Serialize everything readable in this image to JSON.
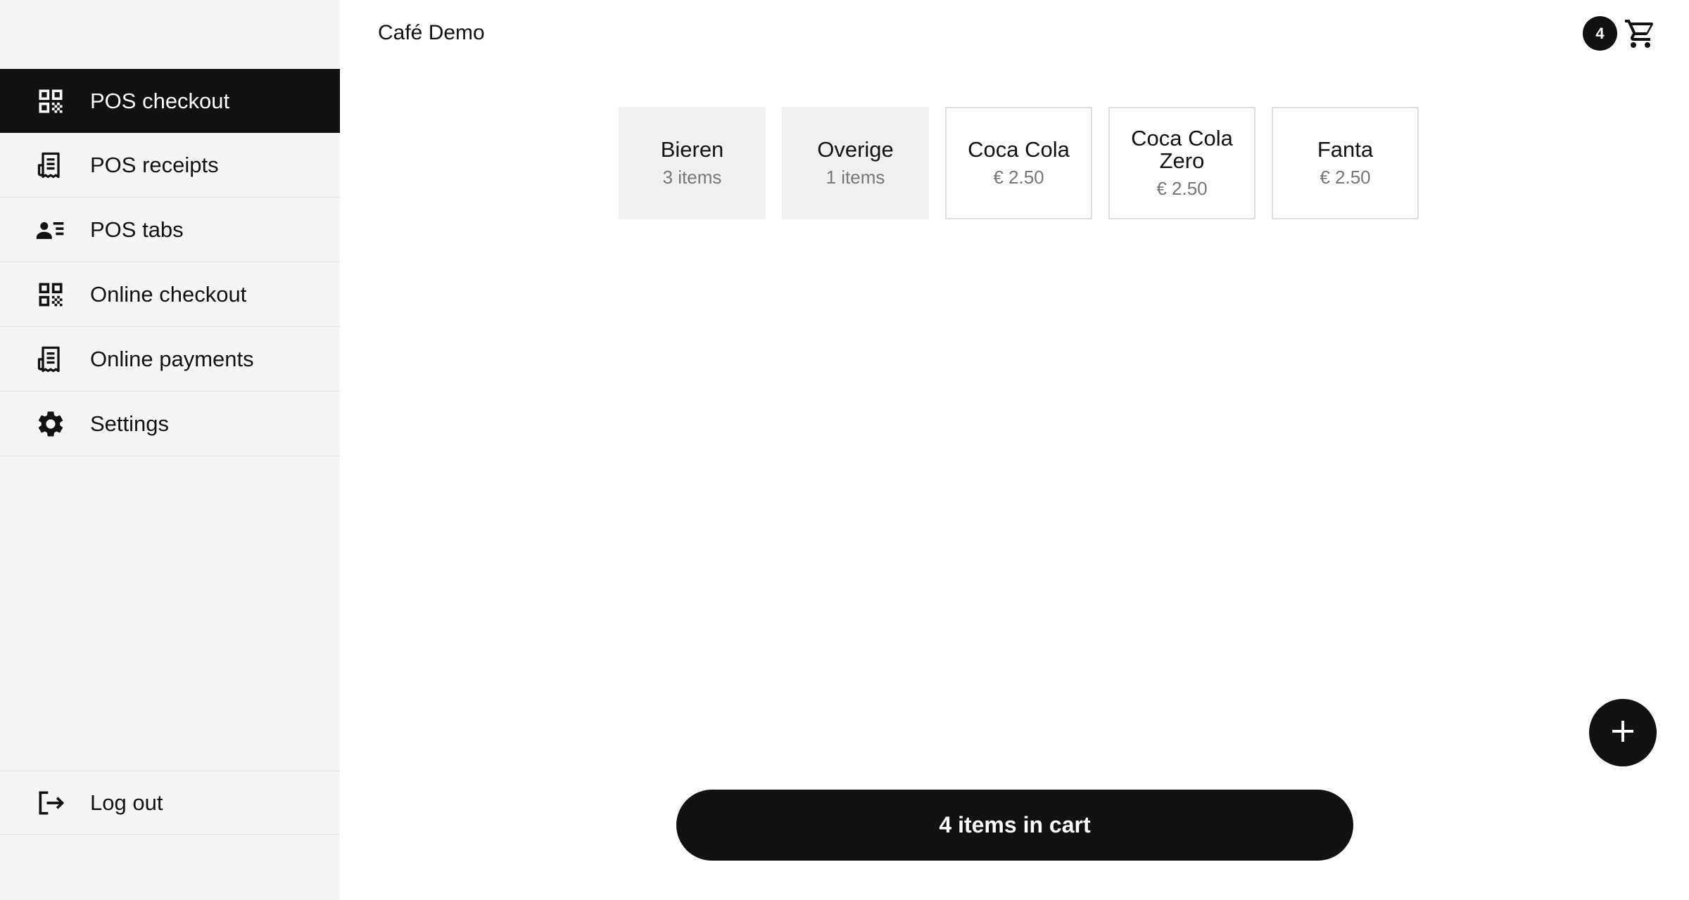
{
  "app": {
    "title": "Café Demo"
  },
  "sidebar": {
    "items": [
      {
        "label": "POS checkout",
        "icon": "qr-code-icon",
        "active": true
      },
      {
        "label": "POS receipts",
        "icon": "receipt-icon",
        "active": false
      },
      {
        "label": "POS tabs",
        "icon": "person-list-icon",
        "active": false
      },
      {
        "label": "Online checkout",
        "icon": "qr-code-icon",
        "active": false
      },
      {
        "label": "Online payments",
        "icon": "receipt-icon",
        "active": false
      },
      {
        "label": "Settings",
        "icon": "gear-icon",
        "active": false
      }
    ],
    "logout": {
      "label": "Log out",
      "icon": "logout-icon"
    }
  },
  "header": {
    "cart_count": "4",
    "cart_icon": "shopping-cart-icon"
  },
  "tiles": [
    {
      "name": "Bieren",
      "sub": "3 items",
      "kind": "category"
    },
    {
      "name": "Overige",
      "sub": "1 items",
      "kind": "category"
    },
    {
      "name": "Coca Cola",
      "sub": "€ 2.50",
      "kind": "product"
    },
    {
      "name": "Coca Cola Zero",
      "sub": "€ 2.50",
      "kind": "product"
    },
    {
      "name": "Fanta",
      "sub": "€ 2.50",
      "kind": "product"
    }
  ],
  "fab": {
    "icon": "plus-icon"
  },
  "checkout": {
    "label": "4 items in cart"
  },
  "colors": {
    "accent": "#111111",
    "sidebar_bg": "#f5f5f5",
    "category_tile_bg": "#f0f0f0"
  }
}
